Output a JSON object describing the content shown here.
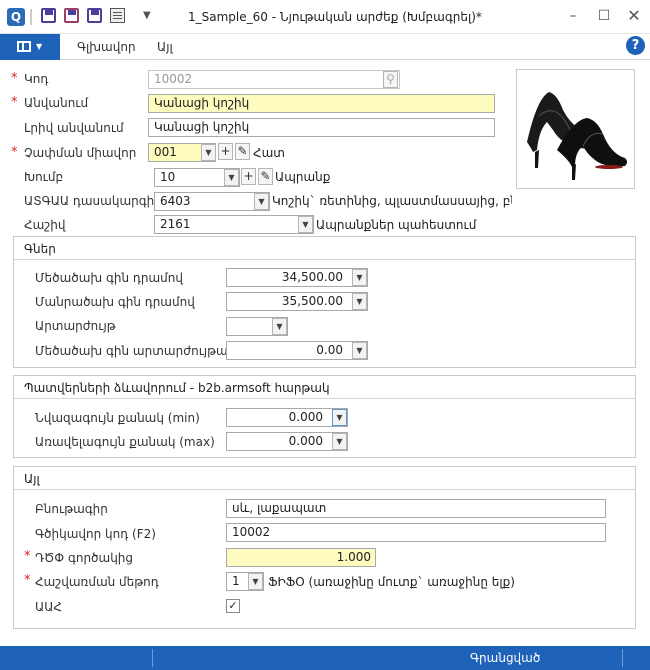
{
  "window": {
    "title": "1_Sample_60 - Նյութական արժեք (Խմբագրել)*",
    "logo_letter": "Q"
  },
  "ribbon": {
    "tabs": [
      "Գլխավոր",
      "Այլ"
    ],
    "help": "?"
  },
  "form": {
    "code": {
      "label": "Կոդ",
      "value": "10002"
    },
    "name": {
      "label": "Անվանում",
      "value": "Կանացի կոշիկ"
    },
    "full_name": {
      "label": "Լրիվ անվանում",
      "value": "Կանացի կոշիկ"
    },
    "unit": {
      "label": "Չափման միավոր",
      "value": "001",
      "after": "Հատ"
    },
    "group": {
      "label": "Խումբ",
      "value": "10",
      "after": "Ապրանք"
    },
    "classifier": {
      "label": "ԱՏԳԱԱ դասակարգիչ",
      "value": "6403",
      "after": "Կոշիկ` ռետինից, պլաստմասսայից, բնակ"
    },
    "account": {
      "label": "Հաշիվ",
      "value": "2161",
      "after": "Ապրանքներ պահեստում"
    }
  },
  "prices": {
    "title": "Գներ",
    "wholesale": {
      "label": "Մեծածախ գին դրամով",
      "value": "34,500.00"
    },
    "retail": {
      "label": "Մանրածախ գին դրամով",
      "value": "35,500.00"
    },
    "currency": {
      "label": "Արտարժույթ",
      "value": ""
    },
    "wholesale_fx": {
      "label": "Մեծածախ գին արտարժույթային",
      "value": "0.00"
    }
  },
  "orders": {
    "title": "Պատվերների ձևավորում - b2b.armsoft հարթակ",
    "min_qty": {
      "label": "Նվազագույն քանակ (min)",
      "value": "0.000"
    },
    "max_qty": {
      "label": "Առավելագույն քանակ (max)",
      "value": "0.000"
    }
  },
  "other": {
    "title": "Այլ",
    "description": {
      "label": "Բնութագիր",
      "value": "սև, լաքապատ"
    },
    "barcode": {
      "label": "Գծիկավոր կոդ (F2)",
      "value": "10002"
    },
    "vat_coef": {
      "label": "ԴԾՓ գործակից",
      "value": "1.000"
    },
    "calc_method": {
      "label": "Հաշվառման մեթոդ",
      "value": "1",
      "after": "ՖԻՖՕ (առաջինը մուտք` առաջինը ելք)"
    },
    "vat": {
      "label": "ԱԱՀ",
      "checked": "✓"
    }
  },
  "status": {
    "text": "Գրանցված"
  },
  "icons": {
    "logo": "app-logo-icon",
    "save": "save-icon",
    "save_close": "save-close-icon",
    "save_new": "save-new-icon",
    "settings": "settings-icon",
    "customize": "customize-caret-icon",
    "minimize": "minimize-icon",
    "maximize": "maximize-icon",
    "close": "close-icon",
    "menu": "menu-icon",
    "dropdown": "chevron-down-icon",
    "add": "plus-icon",
    "edit": "pencil-icon",
    "help": "help-icon",
    "picture": "shoe-image"
  },
  "colors": {
    "accent": "#1e62b9",
    "required": "#d9241c",
    "highlight": "#fdfbbe"
  }
}
